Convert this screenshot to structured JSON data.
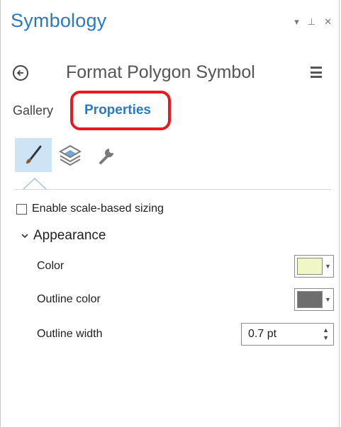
{
  "pane": {
    "title": "Symbology",
    "controls": {
      "dropdown": "▾",
      "pin": "⊥",
      "close": "✕"
    }
  },
  "header": {
    "back_icon": "back-arrow-icon",
    "title": "Format Polygon Symbol",
    "menu_icon": "hamburger-menu-icon"
  },
  "tabs": [
    {
      "label": "Gallery",
      "active": false
    },
    {
      "label": "Properties",
      "active": true
    }
  ],
  "highlight_color": "#e8191f",
  "toolbar": {
    "icons": [
      "paintbrush-icon",
      "layers-icon",
      "wrench-icon"
    ],
    "active_index": 0
  },
  "scale_option": {
    "label": "Enable scale-based sizing",
    "checked": false
  },
  "appearance": {
    "label": "Appearance",
    "expanded": true,
    "properties": {
      "color": {
        "label": "Color",
        "value": "#f0f7c4"
      },
      "outline_color": {
        "label": "Outline color",
        "value": "#6e6e6e"
      },
      "outline_width": {
        "label": "Outline width",
        "value": "0.7 pt"
      }
    }
  },
  "accent_color": "#2b79c5"
}
